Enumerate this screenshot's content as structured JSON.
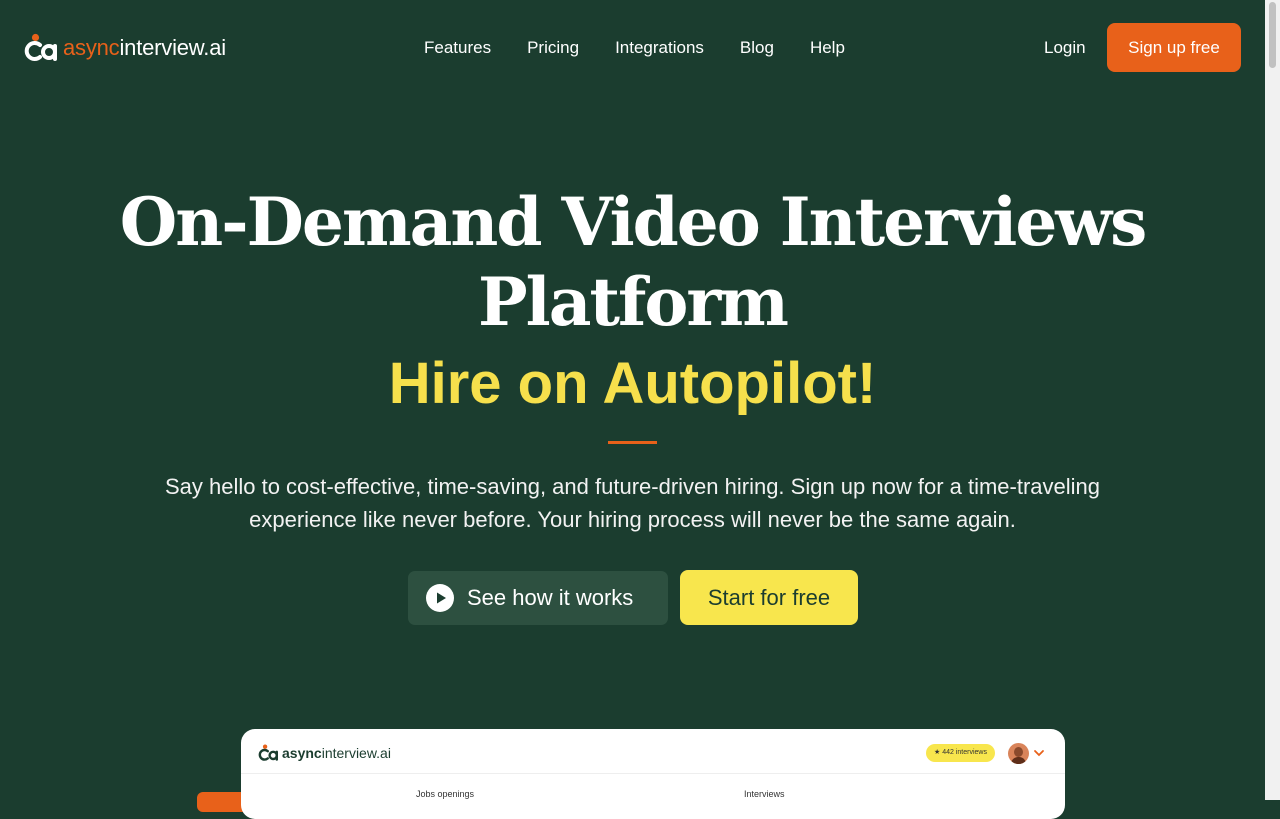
{
  "brand": {
    "part1": "async",
    "part2": "interview.ai",
    "accent_color": "#e8611a",
    "background_color": "#1b3d2f"
  },
  "nav": {
    "items": [
      {
        "label": "Features"
      },
      {
        "label": "Pricing"
      },
      {
        "label": "Integrations"
      },
      {
        "label": "Blog"
      },
      {
        "label": "Help"
      }
    ],
    "login": "Login",
    "signup": "Sign up free"
  },
  "hero": {
    "title_line1": "On-Demand Video Interviews",
    "title_line2": "Platform",
    "subtitle": "Hire on Autopilot!",
    "subtitle_color": "#f6e04c",
    "description_line1": "Say hello to cost-effective, time-saving, and future-driven hiring. Sign up now for a time-traveling",
    "description_line2": "experience like never before. Your hiring process will never be the same again.",
    "cta_secondary": "See how it works",
    "cta_secondary_icon": "play-circle-icon",
    "cta_primary": "Start for free"
  },
  "preview": {
    "brand_part1": "async",
    "brand_part2": "interview.ai",
    "badge": "442 interviews",
    "badge_icon": "star-icon",
    "col_jobs": "Jobs openings",
    "col_interviews": "Interviews"
  }
}
